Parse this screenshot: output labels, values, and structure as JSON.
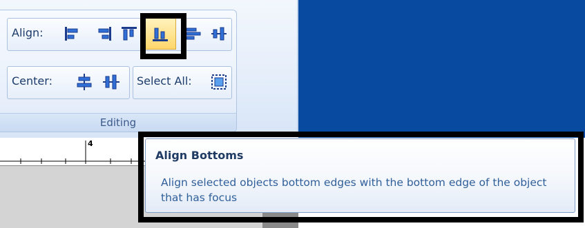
{
  "ribbon": {
    "group_name": "Editing",
    "align_label": "Align:",
    "center_label": "Center:",
    "select_all_label": "Select All:",
    "align_buttons": [
      {
        "icon": "align-lefts-icon"
      },
      {
        "icon": "align-rights-icon"
      },
      {
        "icon": "align-tops-icon"
      },
      {
        "icon": "align-bottoms-icon",
        "selected": true
      },
      {
        "icon": "align-vertical-centers-icon"
      },
      {
        "icon": "align-horizontal-centers-icon"
      }
    ],
    "center_buttons": [
      {
        "icon": "center-horizontally-icon"
      },
      {
        "icon": "center-vertically-icon"
      }
    ],
    "select_all_button": {
      "icon": "select-all-icon"
    }
  },
  "ruler": {
    "tick_label": "4"
  },
  "tooltip": {
    "title": "Align Bottoms",
    "description": "Align selected objects bottom edges with the bottom edge of the object that has focus"
  },
  "colors": {
    "accent_blue": "#084aa0",
    "highlight": "#ffd66b",
    "frame": "#000000"
  }
}
